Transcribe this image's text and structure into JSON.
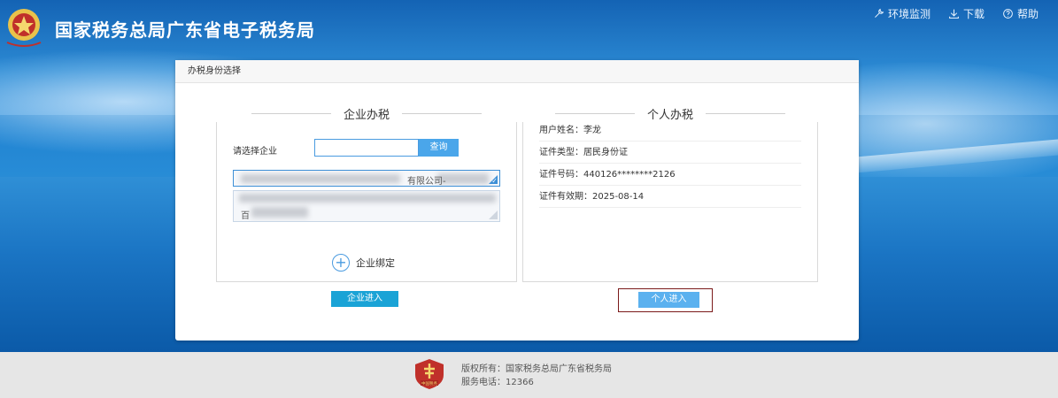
{
  "header": {
    "site_title": "国家税务总局广东省电子税务局",
    "links": [
      {
        "icon": "wrench-icon",
        "label": "环境监测"
      },
      {
        "icon": "download-icon",
        "label": "下载"
      },
      {
        "icon": "help-circle-icon",
        "label": "帮助"
      }
    ]
  },
  "card": {
    "title": "办税身份选择",
    "enterprise": {
      "section_title": "企业办税",
      "select_label": "请选择企业",
      "select_input_value": "",
      "query_label": "查询",
      "companies": [
        {
          "text_visible": "有限公司-",
          "selected": true
        },
        {
          "text_visible": "百",
          "selected": false
        }
      ],
      "bind_label": "企业绑定",
      "enter_label": "企业进入"
    },
    "personal": {
      "section_title": "个人办税",
      "info": [
        "用户姓名：李龙",
        "证件类型：居民身份证",
        "证件号码：440126********2126",
        "证件有效期：2025-08-14"
      ],
      "enter_label": "个人进入"
    }
  },
  "footer": {
    "emblem_text": "中国税务",
    "copyright": "版权所有：国家税务总局广东省税务局",
    "phone": "服务电话：12366"
  },
  "colors": {
    "accent_blue": "#4aa6ea",
    "enterprise_button": "#1aa3d6",
    "personal_button": "#5bb1ef",
    "highlight_frame": "#7b1a1a",
    "emblem_red": "#c0302a"
  }
}
